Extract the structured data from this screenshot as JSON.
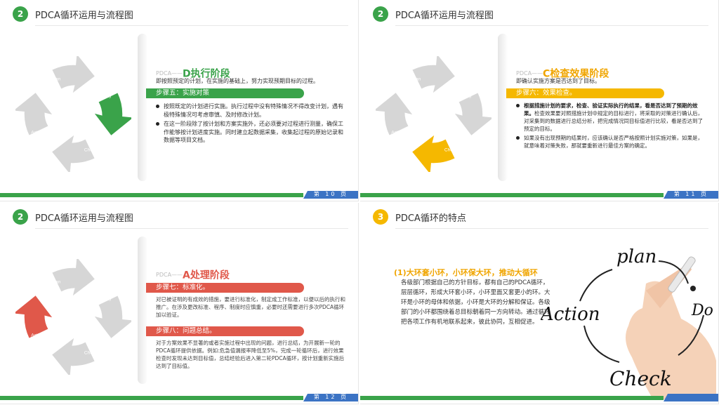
{
  "colors": {
    "green": "#3aa34a",
    "orange": "#f5b800",
    "red": "#e0584a",
    "blue": "#3b73c4",
    "grey_arrow": "#d6d6d6",
    "gold": "#f0a500"
  },
  "cycle_labels": {
    "plan": "Plan",
    "do": "Do",
    "check": "Check",
    "action": "Action"
  },
  "slides": [
    {
      "badge": "2",
      "title": "PDCA循环运用与流程图",
      "page_label": "第 10 页",
      "prefix": "PDCA——",
      "phase_title": "D执行阶段",
      "intro": "即按照预定的计划，在实施的基础上，努力实现预期目标的过程。",
      "step": "步骤五：实施对策",
      "bullets": [
        "按照既定的计划进行实施。执行过程中没有特殊情况不得改变计划，遇有极特殊情况可考虑审慎、及时修改计划。",
        "在这一阶段除了按计划和方案实施外，还必须要对过程进行测量，确保工作能够按计划进度实施。同时建立起数据采集，收集起过程的原始记录和数据等项目文档。"
      ]
    },
    {
      "badge": "2",
      "title": "PDCA循环运用与流程图",
      "page_label": "第 11 页",
      "prefix": "PDCA——",
      "phase_title": "C检查效果阶段",
      "intro": "即确认实施方案是否达到了目标。",
      "step": "步骤六：效果检查。",
      "bullet1_bold": "根据措施计划的要求，检查、验证实际执行的结果，看是否达到了预期的效果。",
      "bullet1_rest": "检查效果要对照措施计划中规定的目标进行，将采取的对策进行确认后，对采集到的数据进行总结分析，把完成情况同目标值进行比较，看是否达到了预定的目标。",
      "bullet2": "如果没有出现预期的结果时，应该确认是否严格按照计划实施对策，如果是，就意味着对策失败，那就要重新进行最佳方案的确定。"
    },
    {
      "badge": "2",
      "title": "PDCA循环运用与流程图",
      "page_label": "第 12 页",
      "prefix": "PDCA——",
      "phase_title": "A处理阶段",
      "step7": "步骤七：标准化。",
      "para7": "对已被证明的有成效的措施，要进行标准化，制定成工作标准，以便以后的执行和推广。在涉及更改标准、程序、制度时应慎重，必要时还需要进行多次PDCA循环加以验证。",
      "step8": "步骤八：问题总结。",
      "para8": "对于方案效果不显著的或者实施过程中出现的问题，进行总结，为开展新一轮的PDCA循环提供依据。例如:危急值漏报率降低至5%，完成一轮循环后，进行效果检查时发现未达到目标值，总结经验后进入第二轮PDCA循环，按计划重新实施后达到了目标值。"
    },
    {
      "badge": "3",
      "title": "PDCA循环的特点",
      "page_label": "",
      "subtitle": "(1)大环套小环，小环保大环，推动大循环",
      "body": "各级部门根据自己的方针目标，都有自己的PDCA循环，层层循环，形成大环套小环，小环里面又套更小的环。大环是小环的母体和依据，小环是大环的分解和保证。各级部门的小环都围绕着总目标朝着同一方向转动。通过循环把各项工作有机地联系起来，彼此协同，互相促进。",
      "hand_words": {
        "plan": "plan",
        "do": "Do",
        "check": "Check",
        "action": "Action"
      }
    }
  ]
}
